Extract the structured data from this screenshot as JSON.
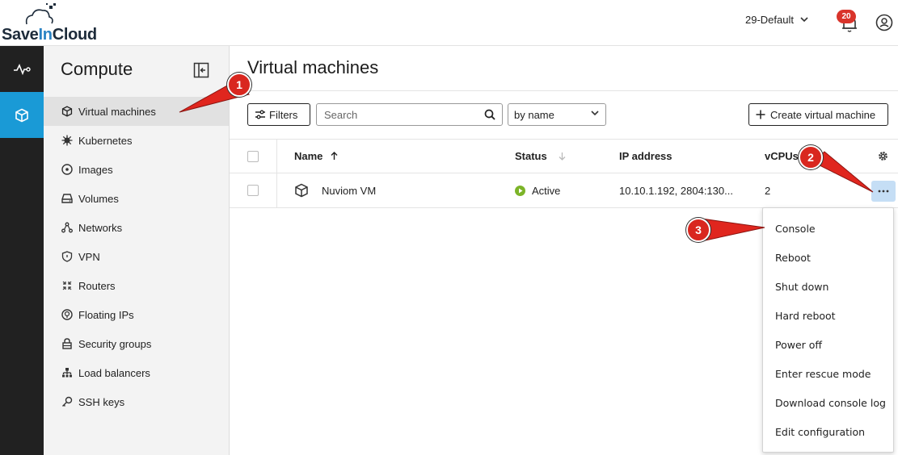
{
  "header": {
    "logo_part1": "Save",
    "logo_part2": "In",
    "logo_part3": "Cloud",
    "project_selector": "29-Default",
    "notification_count": "20"
  },
  "sidebar": {
    "title": "Compute",
    "items": [
      {
        "label": "Virtual machines",
        "icon": "cube-icon"
      },
      {
        "label": "Kubernetes",
        "icon": "kubernetes-icon"
      },
      {
        "label": "Images",
        "icon": "image-icon"
      },
      {
        "label": "Volumes",
        "icon": "volume-icon"
      },
      {
        "label": "Networks",
        "icon": "network-icon"
      },
      {
        "label": "VPN",
        "icon": "shield-icon"
      },
      {
        "label": "Routers",
        "icon": "router-icon"
      },
      {
        "label": "Floating IPs",
        "icon": "floating-ip-icon"
      },
      {
        "label": "Security groups",
        "icon": "lock-icon"
      },
      {
        "label": "Load balancers",
        "icon": "load-balancer-icon"
      },
      {
        "label": "SSH keys",
        "icon": "key-icon"
      }
    ]
  },
  "main": {
    "title": "Virtual machines",
    "filters_label": "Filters",
    "search_placeholder": "Search",
    "sort_value": "by name",
    "create_label": "Create virtual machine"
  },
  "table": {
    "columns": {
      "name": "Name",
      "status": "Status",
      "ip": "IP address",
      "vcpus": "vCPUs"
    },
    "rows": [
      {
        "name": "Nuviom VM",
        "status": "Active",
        "ip": "10.10.1.192, 2804:130...",
        "vcpus": "2"
      }
    ]
  },
  "context_menu": {
    "items": [
      "Console",
      "Reboot",
      "Shut down",
      "Hard reboot",
      "Power off",
      "Enter rescue mode",
      "Download console log",
      "Edit configuration"
    ]
  },
  "annotations": [
    "1",
    "2",
    "3"
  ],
  "colors": {
    "accent": "#1a9ad6",
    "rail_bg": "#212121",
    "status_active": "#7cb428",
    "annotation": "#d9271f"
  }
}
